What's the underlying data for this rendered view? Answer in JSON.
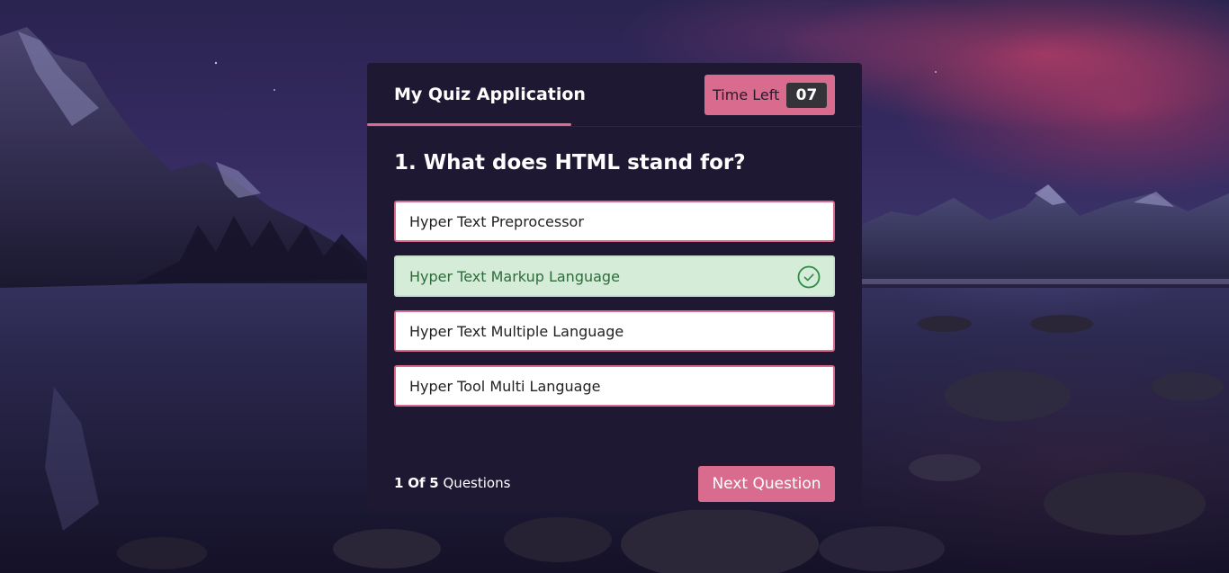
{
  "header": {
    "title": "My Quiz Application",
    "timer_label": "Time Left",
    "timer_value": "07"
  },
  "question": {
    "text": "1. What does HTML stand for?"
  },
  "options": [
    {
      "label": "Hyper Text Preprocessor",
      "state": "default"
    },
    {
      "label": "Hyper Text Markup Language",
      "state": "correct",
      "icon": "check-circle-icon"
    },
    {
      "label": "Hyper Text Multiple Language",
      "state": "default"
    },
    {
      "label": "Hyper Tool Multi Language",
      "state": "default"
    }
  ],
  "footer": {
    "current": "1",
    "of": "Of",
    "total": "5",
    "suffix": "Questions",
    "next_label": "Next Question"
  },
  "colors": {
    "accent": "#d86b8e",
    "card_bg": "#1f1833",
    "correct_bg": "#d4ecd8",
    "correct_fg": "#2f6b3a",
    "timer_box": "#343438"
  }
}
